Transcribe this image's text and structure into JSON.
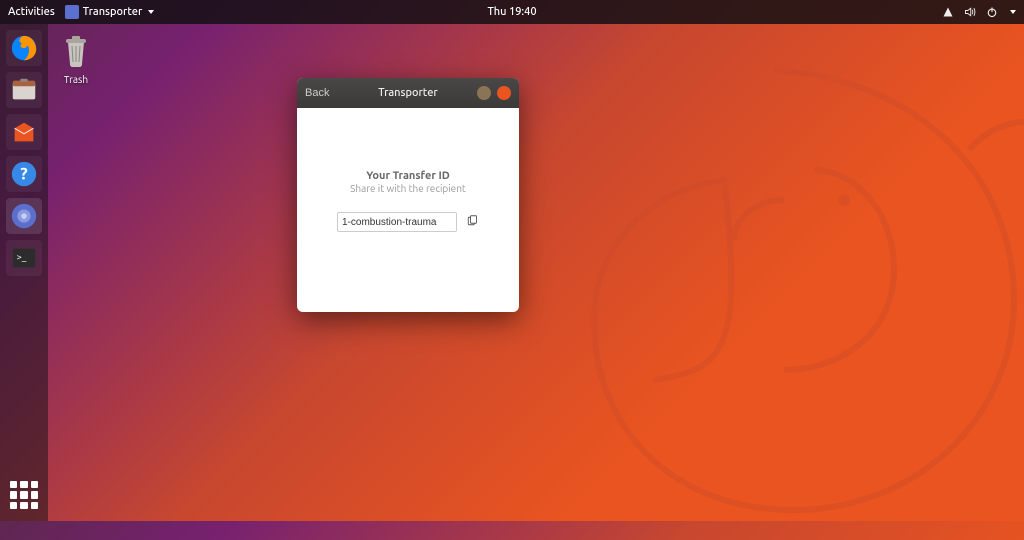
{
  "topbar": {
    "activities": "Activities",
    "app_name": "Transporter",
    "clock": "Thu 19:40"
  },
  "desktop": {
    "trash_label": "Trash"
  },
  "window": {
    "back_label": "Back",
    "title": "Transporter",
    "heading": "Your Transfer ID",
    "subheading": "Share it with the recipient",
    "transfer_id": "1-combustion-trauma"
  },
  "icons": {
    "network": "network-icon",
    "volume": "volume-icon",
    "power": "power-icon"
  }
}
